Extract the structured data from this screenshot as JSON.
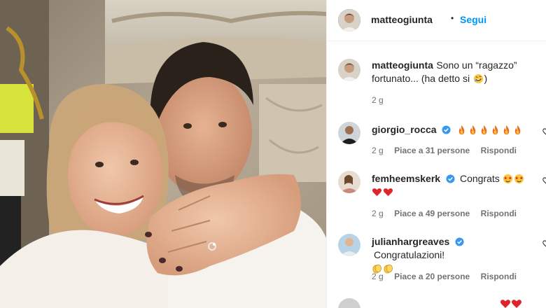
{
  "post": {
    "author": "matteogiunta",
    "follow_label": "Segui",
    "separator": "•",
    "caption_line1": "Sono un “ragazzo”",
    "caption_line2": "fortunato... (ha detto si",
    "caption_end": ")",
    "caption_emoji": "rolling-on-floor-laughing",
    "time": "2 g"
  },
  "comments": [
    {
      "username": "giorgio_rocca",
      "verified": true,
      "text": "",
      "emojis": [
        "fire",
        "fire",
        "fire",
        "fire",
        "fire",
        "fire"
      ],
      "time": "2 g",
      "likes": "Piace a 31 persone",
      "reply": "Rispondi"
    },
    {
      "username": "femheemskerk",
      "verified": true,
      "text": "Congrats",
      "emojis": [
        "star-struck",
        "star-struck"
      ],
      "emojis_line2": [
        "red-heart",
        "red-heart"
      ],
      "time": "2 g",
      "likes": "Piace a 49 persone",
      "reply": "Rispondi"
    },
    {
      "username": "julianhargreaves",
      "verified": true,
      "text": "Congratulazioni!",
      "emojis_line2": [
        "clapping-hands",
        "clapping-hands"
      ],
      "time": "2 g",
      "likes": "Piace a 20 persone",
      "reply": "Rispondi"
    }
  ],
  "colors": {
    "link_blue": "#0095f6",
    "verified_blue": "#3897f0",
    "muted": "#737373"
  }
}
